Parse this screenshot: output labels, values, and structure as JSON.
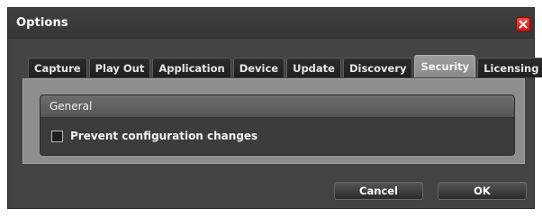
{
  "window": {
    "title": "Options",
    "close_icon": "close-icon"
  },
  "tabs": [
    {
      "label": "Capture",
      "active": false
    },
    {
      "label": "Play Out",
      "active": false
    },
    {
      "label": "Application",
      "active": false
    },
    {
      "label": "Device",
      "active": false
    },
    {
      "label": "Update",
      "active": false
    },
    {
      "label": "Discovery",
      "active": false
    },
    {
      "label": "Security",
      "active": true
    },
    {
      "label": "Licensing",
      "active": false
    }
  ],
  "security": {
    "group_title": "General",
    "prevent_changes": {
      "label": "Prevent configuration changes",
      "checked": false
    }
  },
  "footer": {
    "cancel_label": "Cancel",
    "ok_label": "OK"
  },
  "colors": {
    "close_button": "#e0261a",
    "window_bg": "#434343",
    "active_tab": "#959595"
  }
}
